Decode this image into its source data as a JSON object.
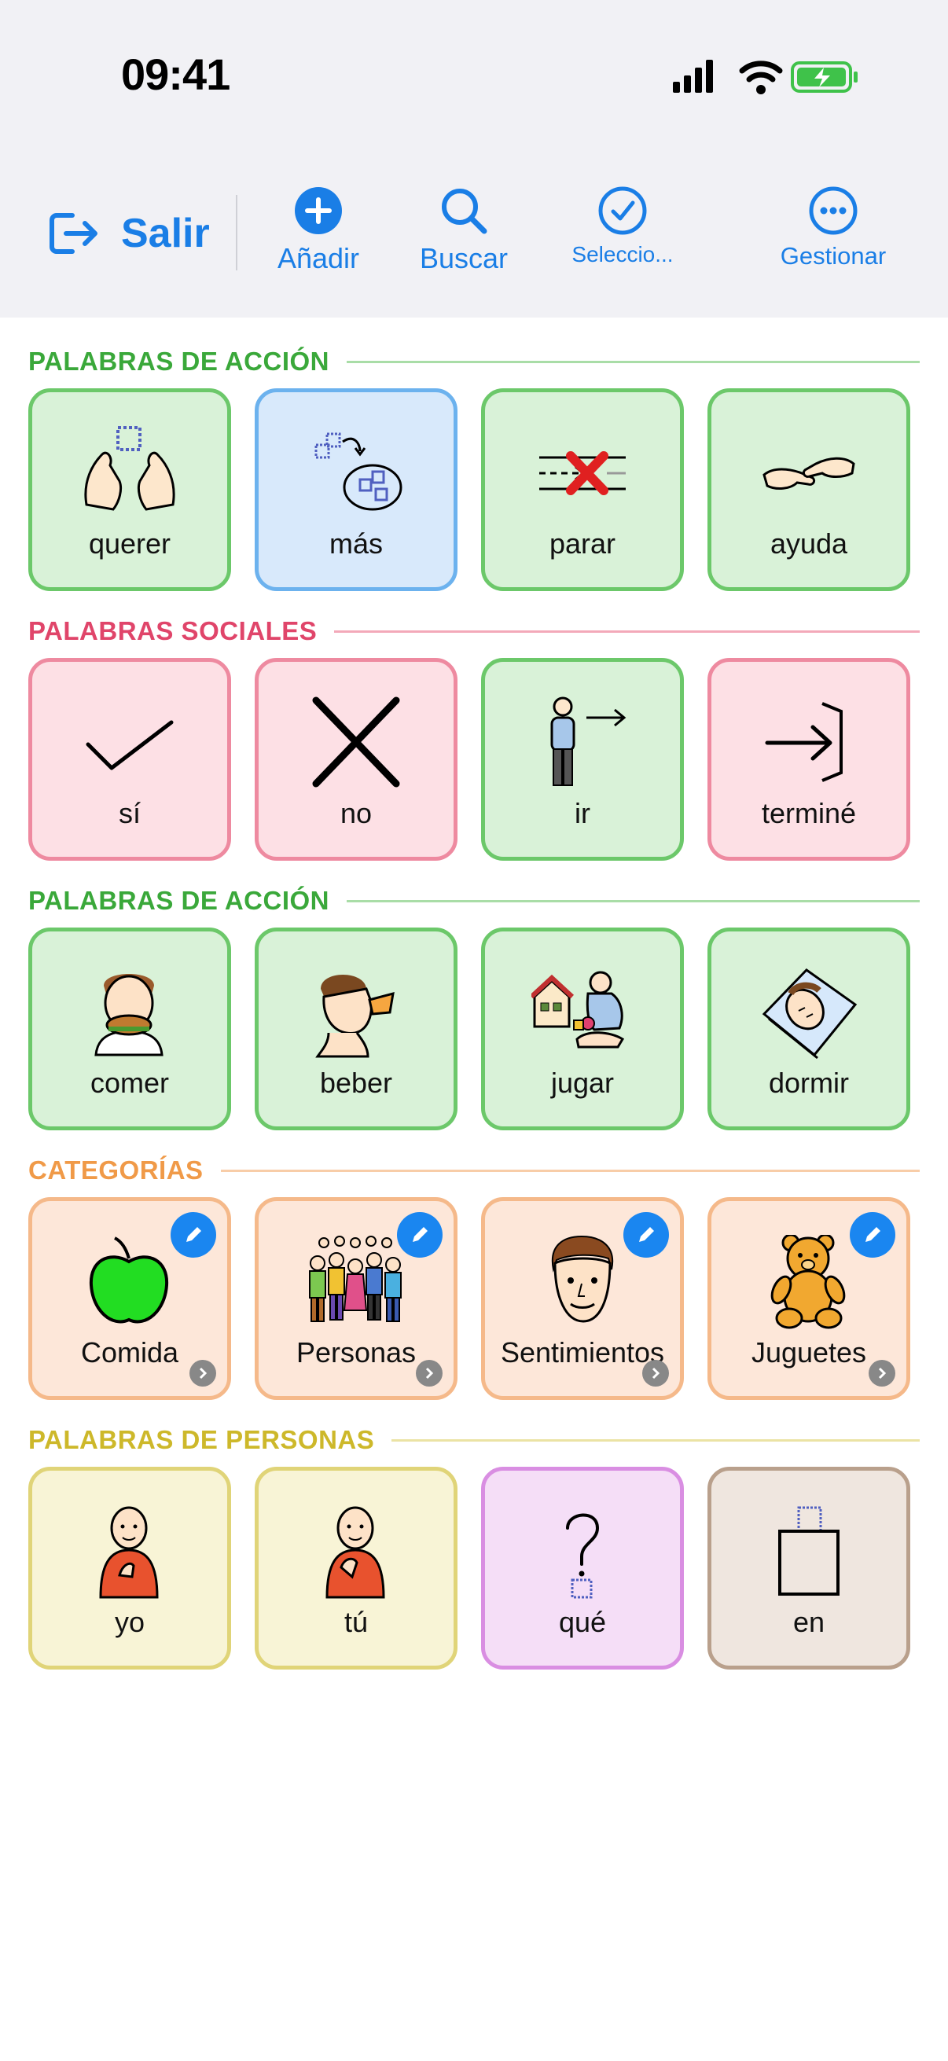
{
  "status": {
    "time": "09:41"
  },
  "toolbar": {
    "exit_label": "Salir",
    "add_label": "Añadir",
    "search_label": "Buscar",
    "select_label": "Seleccio...",
    "manage_label": "Gestionar"
  },
  "colors": {
    "accent": "#1a7ee6",
    "action": "#3aa83a",
    "social": "#e0456a",
    "categories": "#f09a48",
    "people": "#cdb82a"
  },
  "sections": [
    {
      "title": "PALABRAS DE ACCIÓN",
      "tiles": [
        {
          "word": "querer",
          "icon": "want-hands-icon"
        },
        {
          "word": "más",
          "icon": "more-icon"
        },
        {
          "word": "parar",
          "icon": "stop-icon"
        },
        {
          "word": "ayuda",
          "icon": "help-hands-icon"
        }
      ]
    },
    {
      "title": "PALABRAS SOCIALES",
      "tiles": [
        {
          "word": "sí",
          "icon": "checkmark-icon"
        },
        {
          "word": "no",
          "icon": "cross-icon"
        },
        {
          "word": "ir",
          "icon": "go-person-icon"
        },
        {
          "word": "terminé",
          "icon": "finished-icon"
        }
      ]
    },
    {
      "title": "PALABRAS DE ACCIÓN",
      "tiles": [
        {
          "word": "comer",
          "icon": "eat-icon"
        },
        {
          "word": "beber",
          "icon": "drink-icon"
        },
        {
          "word": "jugar",
          "icon": "play-icon"
        },
        {
          "word": "dormir",
          "icon": "sleep-icon"
        }
      ]
    },
    {
      "title": "CATEGORÍAS",
      "tiles": [
        {
          "word": "Comida",
          "icon": "apple-icon"
        },
        {
          "word": "Personas",
          "icon": "people-group-icon"
        },
        {
          "word": "Sentimientos",
          "icon": "face-icon"
        },
        {
          "word": "Juguetes",
          "icon": "teddy-bear-icon"
        }
      ]
    },
    {
      "title": "PALABRAS DE PERSONAS",
      "tiles": [
        {
          "word": "yo",
          "icon": "me-icon"
        },
        {
          "word": "tú",
          "icon": "you-icon"
        },
        {
          "word": "qué",
          "icon": "question-icon"
        },
        {
          "word": "en",
          "icon": "in-icon"
        }
      ]
    }
  ]
}
